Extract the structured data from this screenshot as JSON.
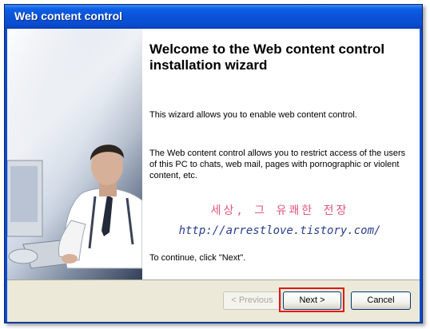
{
  "window": {
    "title": "Web content control"
  },
  "wizard": {
    "heading": "Welcome to the Web content control installation wizard",
    "intro": "This wizard allows you to enable web content control.",
    "description": "The Web content control allows you to restrict access of the users of this PC to chats, web mail, pages with pornographic or violent content, etc.",
    "continue_hint": "To continue, click \"Next\"."
  },
  "watermark": {
    "korean": "세상, 그 유쾌한 전장",
    "url": "http://arrestlove.tistory.com/"
  },
  "buttons": {
    "back": "< Previous",
    "next": "Next >",
    "cancel": "Cancel"
  },
  "colors": {
    "title_bar": "#0a52d8",
    "highlight": "#e11717",
    "watermark_korean": "#e0567a",
    "watermark_url": "#2a3e8e"
  }
}
